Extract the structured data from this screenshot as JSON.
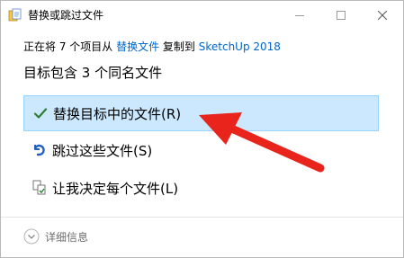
{
  "window": {
    "title": "替换或跳过文件",
    "icon": "file-copy-icon",
    "controls": [
      "minimize-icon",
      "maximize-icon",
      "close-icon"
    ]
  },
  "copy_info": {
    "prefix": "正在将 7 个项目从 ",
    "source": "替换文件",
    "middle": " 复制到 ",
    "destination": "SketchUp 2018"
  },
  "heading": "目标包含 3 个同名文件",
  "options": [
    {
      "label": "替换目标中的文件(R)",
      "icon": "checkmark-icon",
      "selected": true
    },
    {
      "label": "跳过这些文件(S)",
      "icon": "skip-icon",
      "selected": false
    },
    {
      "label": "让我决定每个文件(L)",
      "icon": "decide-files-icon",
      "selected": false
    }
  ],
  "details": {
    "label": "详细信息",
    "icon": "chevron-down-icon"
  },
  "annotation": {
    "icon": "red-arrow-icon",
    "color": "#e8241c"
  },
  "colors": {
    "selected_bg": "#cce8ff",
    "selected_border": "#99d1ff",
    "link": "#0066cc",
    "check": "#2e7d32"
  }
}
